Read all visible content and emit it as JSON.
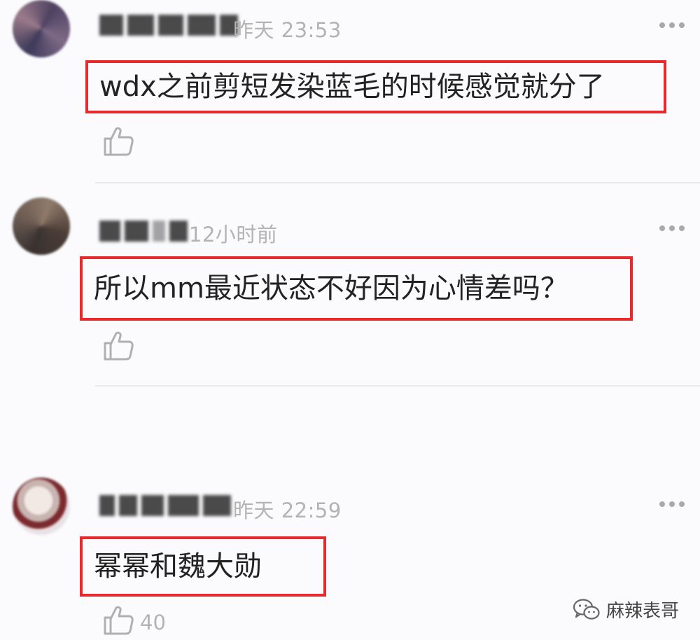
{
  "comments": [
    {
      "time": "昨天 23:53",
      "text": "wdx之前剪短发染蓝毛的时候感觉就分了",
      "like_count": ""
    },
    {
      "time": "12小时前",
      "text": "所以mm最近状态不好因为心情差吗？",
      "like_count": ""
    },
    {
      "time": "昨天 22:59",
      "text": "幂幂和魏大勋",
      "like_count": "40"
    }
  ],
  "watermark": {
    "label": "麻辣表哥",
    "icon": "wechat-icon"
  },
  "colors": {
    "highlight_border": "#e8292e",
    "meta_text": "#b3b3b3",
    "background": "#fbfbfd"
  },
  "icons": {
    "like": "thumbs-up-icon",
    "more": "more-dots-icon"
  }
}
